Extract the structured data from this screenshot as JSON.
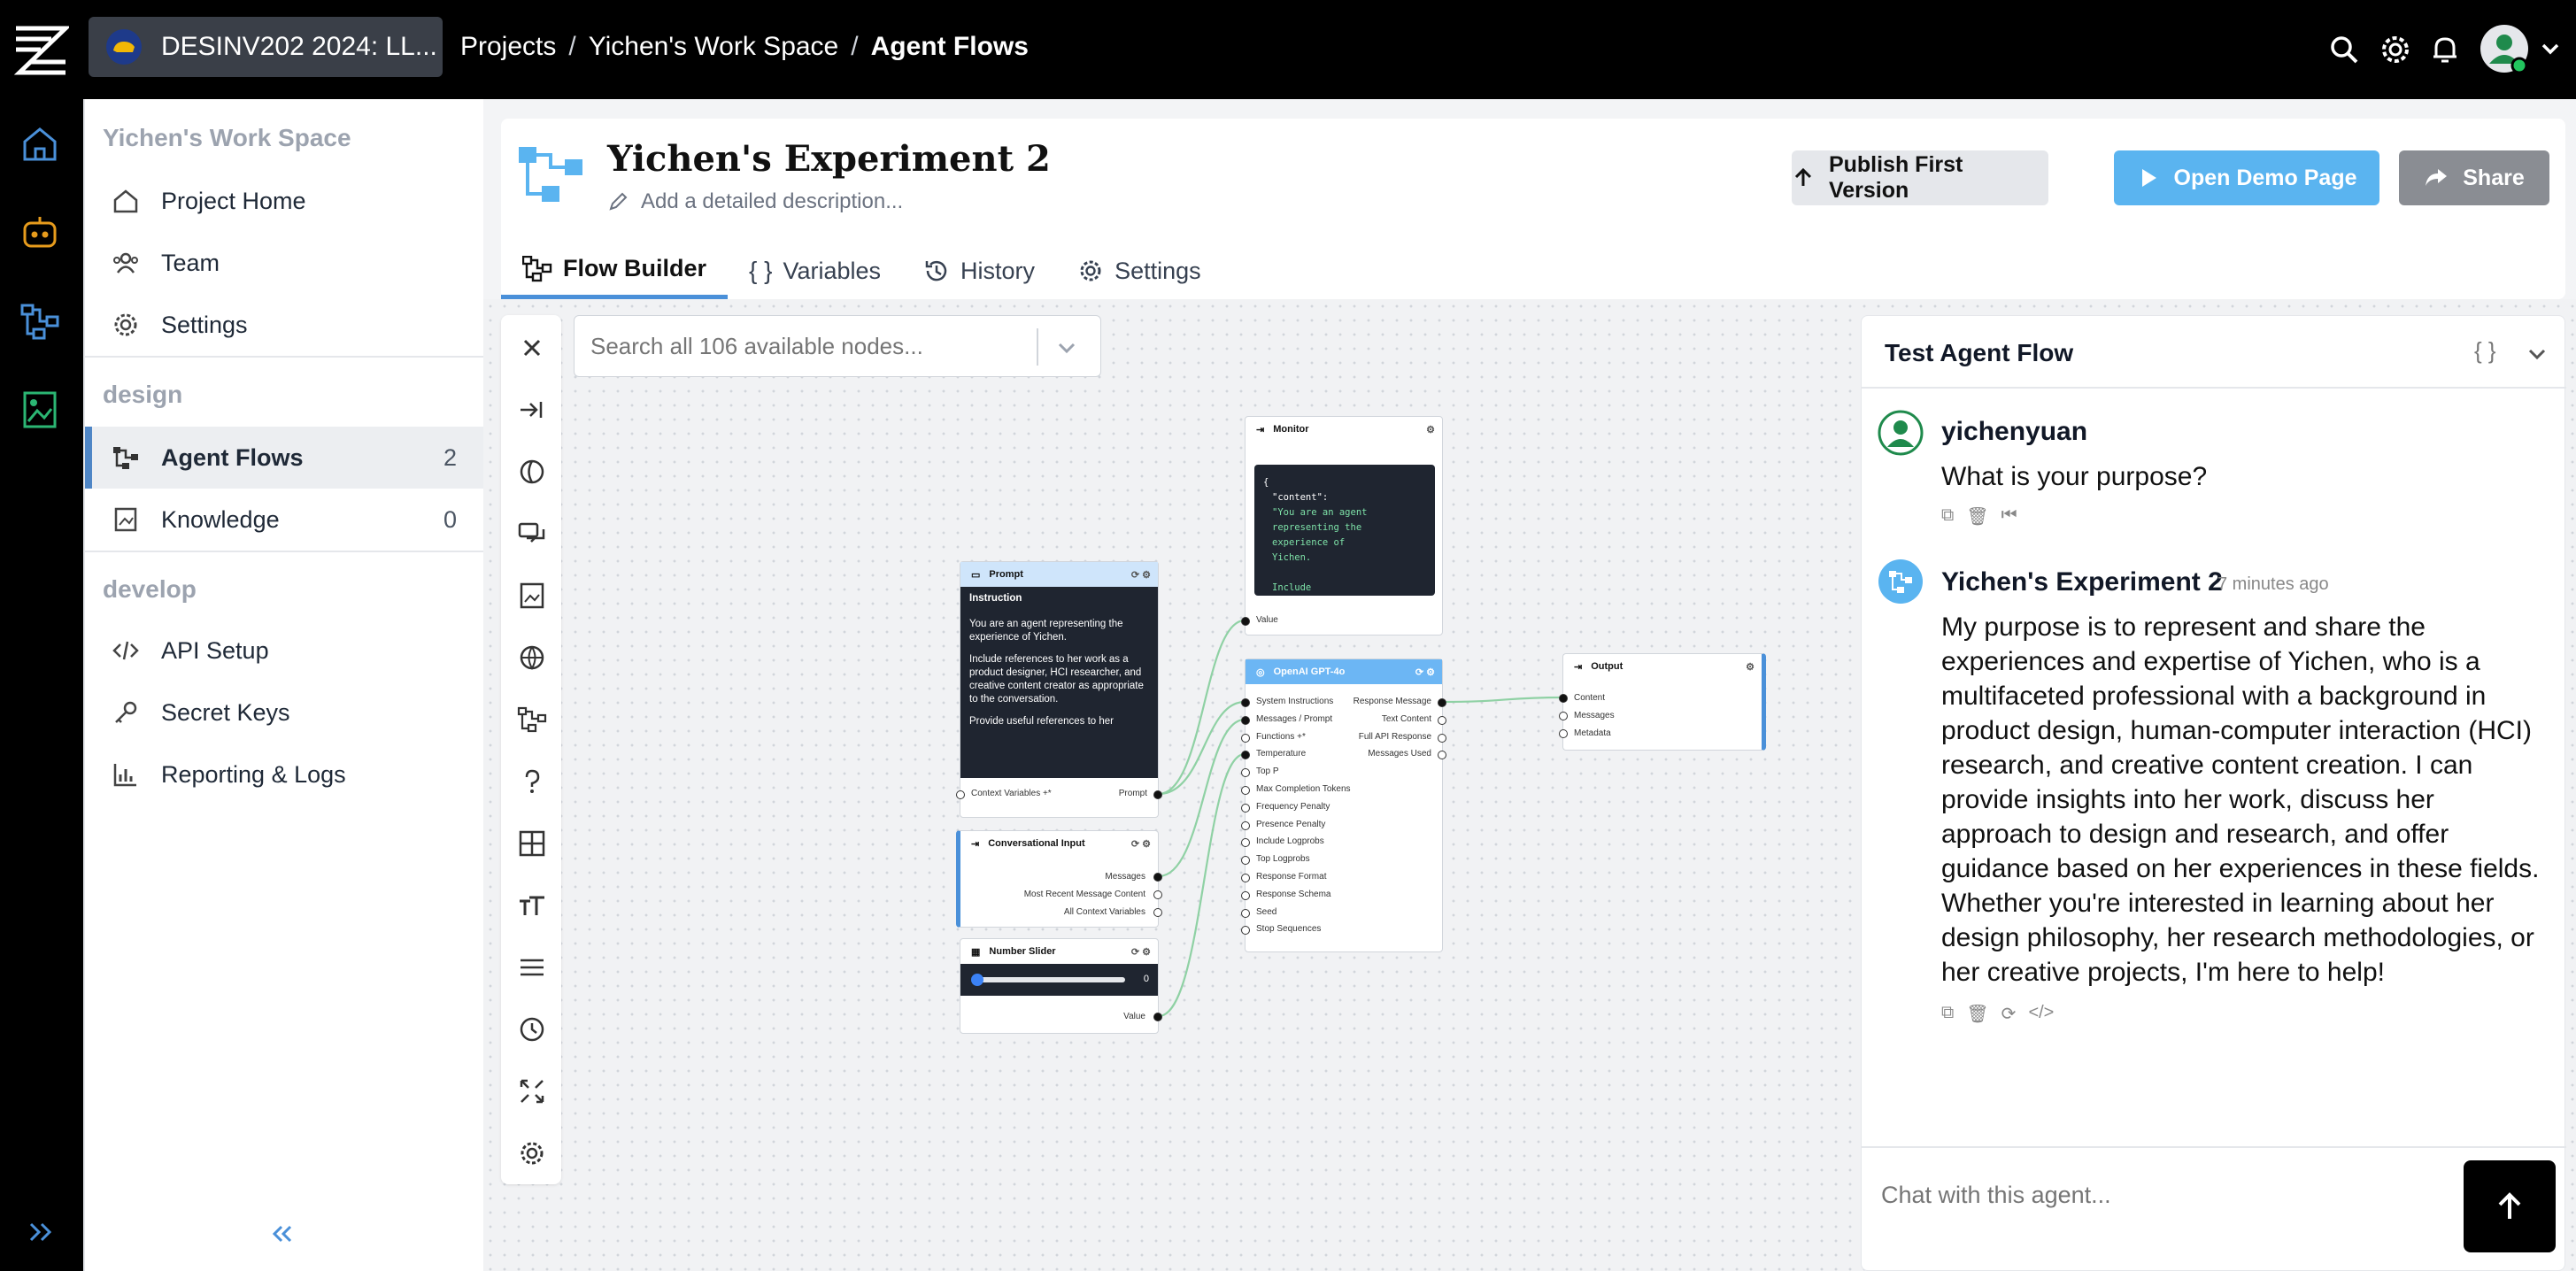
{
  "topbar": {
    "project_name": "DESINV202 2024: LL...",
    "breadcrumbs": [
      "Projects",
      "Yichen's Work Space",
      "Agent Flows"
    ]
  },
  "sidebar": {
    "workspace_title": "Yichen's Work Space",
    "items_top": [
      {
        "label": "Project Home",
        "icon": "home-icon"
      },
      {
        "label": "Team",
        "icon": "team-icon"
      },
      {
        "label": "Settings",
        "icon": "gear-icon"
      }
    ],
    "design_header": "design",
    "design_items": [
      {
        "label": "Agent Flows",
        "count": "2",
        "icon": "flow-icon",
        "active": true
      },
      {
        "label": "Knowledge",
        "count": "0",
        "icon": "knowledge-icon"
      }
    ],
    "develop_header": "develop",
    "develop_items": [
      {
        "label": "API Setup",
        "icon": "code-icon"
      },
      {
        "label": "Secret Keys",
        "icon": "key-icon"
      },
      {
        "label": "Reporting & Logs",
        "icon": "chart-icon"
      }
    ]
  },
  "flow": {
    "title": "Yichen's Experiment 2",
    "description_placeholder": "Add a detailed description...",
    "publish_label": "Publish First Version",
    "demo_label": "Open Demo Page",
    "share_label": "Share",
    "tabs": [
      "Flow Builder",
      "Variables",
      "History",
      "Settings"
    ]
  },
  "canvas": {
    "search_placeholder": "Search all 106 available nodes...",
    "nodes": {
      "prompt": {
        "title": "Prompt",
        "subtitle": "Instruction",
        "text1": "You are an agent representing the experience of Yichen.",
        "text2": "Include references to her work as a product designer, HCI researcher, and creative content creator as appropriate to the conversation.",
        "text3": "Provide useful references to her",
        "in_label": "Context Variables +*",
        "out_label": "Prompt"
      },
      "monitor": {
        "title": "Monitor",
        "code_lines": [
          "{",
          "\"content\":",
          "\"You are an agent",
          "representing the",
          "experience of",
          "Yichen.",
          "",
          "Include"
        ],
        "in_label": "Value"
      },
      "openai": {
        "title": "OpenAI GPT-4o",
        "inputs": [
          "System Instructions",
          "Messages / Prompt",
          "Functions +*",
          "Temperature",
          "Top P",
          "Max Completion Tokens",
          "Frequency Penalty",
          "Presence Penalty",
          "Include Logprobs",
          "Top Logprobs",
          "Response Format",
          "Response Schema",
          "Seed",
          "Stop Sequences"
        ],
        "outputs": [
          "Response Message",
          "Text Content",
          "Full API Response",
          "Messages Used"
        ]
      },
      "conversational": {
        "title": "Conversational Input",
        "outputs": [
          "Messages",
          "Most Recent Message Content",
          "All Context Variables"
        ]
      },
      "slider": {
        "title": "Number Slider",
        "value": "0",
        "out_label": "Value"
      },
      "output": {
        "title": "Output",
        "inputs": [
          "Content",
          "Messages",
          "Metadata"
        ]
      }
    }
  },
  "test_panel": {
    "title": "Test Agent Flow",
    "user_name": "yichenyuan",
    "user_message": "What is your purpose?",
    "agent_name": "Yichen's Experiment 2",
    "agent_time": "7 minutes ago",
    "agent_message": "My purpose is to represent and share the experiences and expertise of Yichen, who is a multifaceted professional with a background in product design, human-computer interaction (HCI) research, and creative content creation. I can provide insights into her work, discuss her approach to design and research, and offer guidance based on her experiences in these fields. Whether you're interested in learning about her design philosophy, her research methodologies, or her creative projects, I'm here to help!",
    "input_placeholder": "Chat with this agent..."
  },
  "colors": {
    "accent_blue": "#4a90d9",
    "demo_button": "#5ab4f0",
    "publish_button": "#e5e7eb",
    "share_button": "#8a8d93",
    "node_blue": "#6cb6f4"
  }
}
